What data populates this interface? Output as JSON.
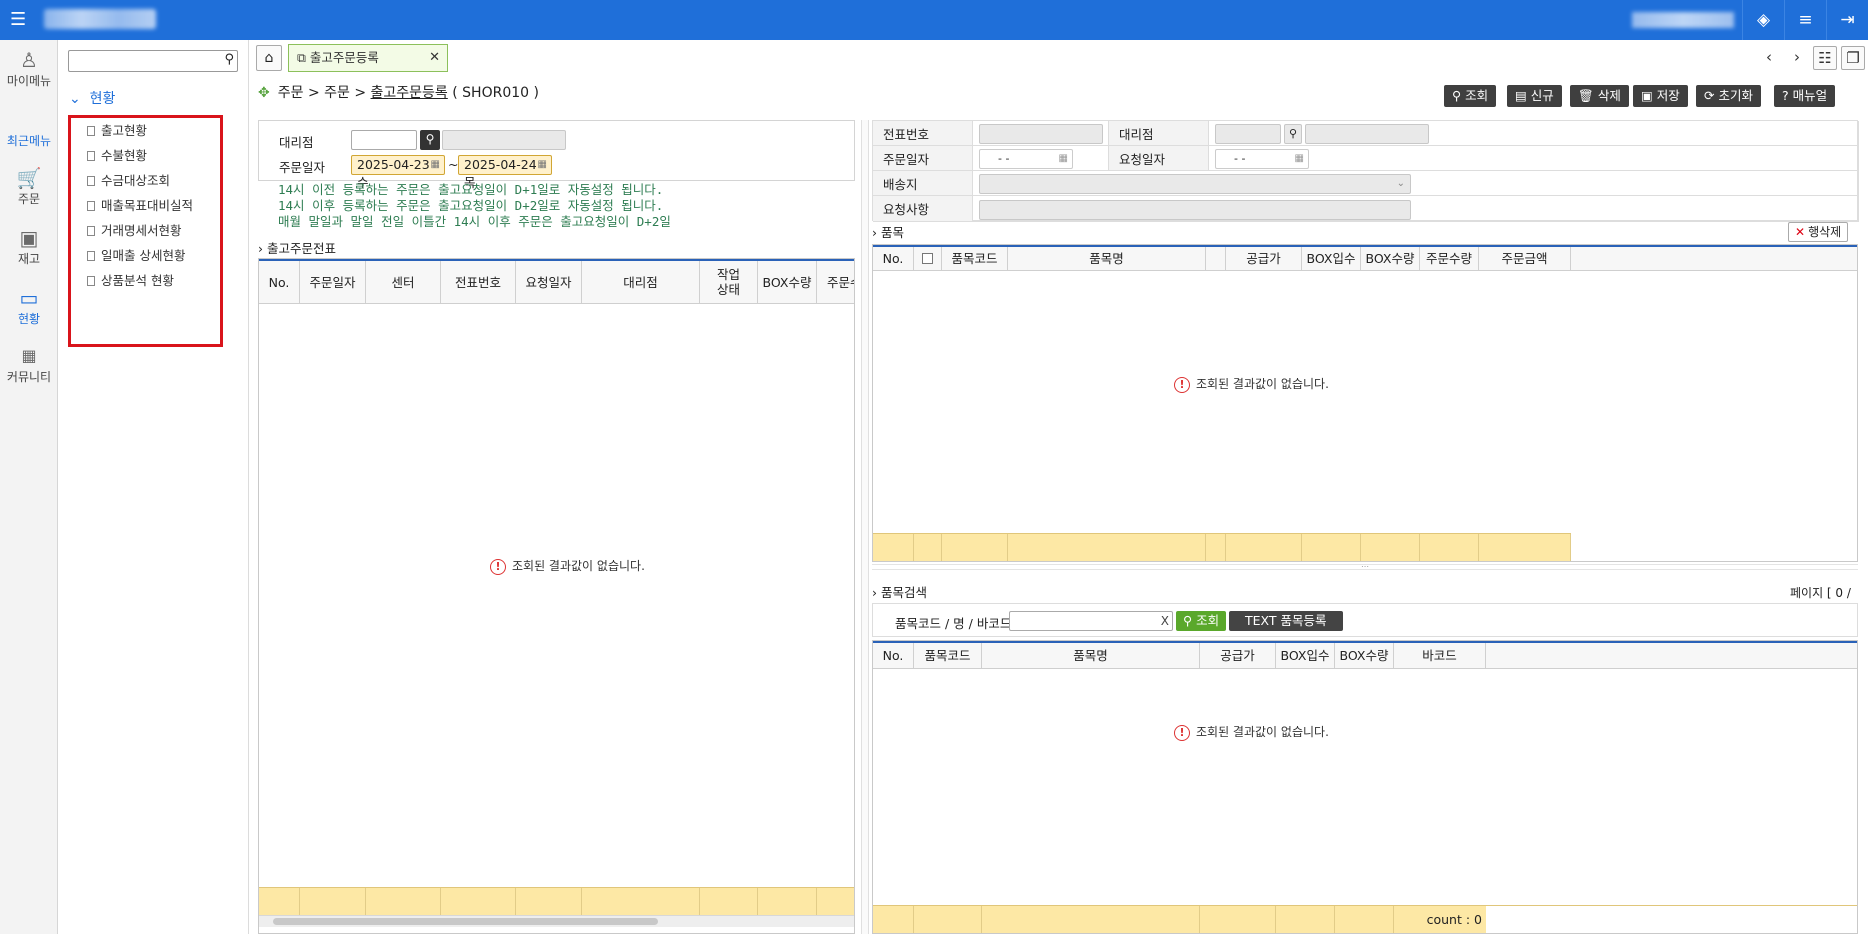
{
  "topbar": {
    "menu_icon": "hamburger-icon",
    "layers_icon": "layers-icon",
    "list_icon": "list-icon",
    "logout_icon": "logout-icon"
  },
  "leftnav": {
    "items": [
      {
        "label": "마이메뉴",
        "icon": "user-icon"
      },
      {
        "label": "최근메뉴",
        "icon": ""
      },
      {
        "label": "주문",
        "icon": "cart-icon"
      },
      {
        "label": "재고",
        "icon": "box-icon"
      },
      {
        "label": "현황",
        "icon": "monitor-icon"
      },
      {
        "label": "커뮤니티",
        "icon": "calendar-icon"
      }
    ]
  },
  "submenu": {
    "search_value": "",
    "group": "현황",
    "items": [
      "출고현황",
      "수불현황",
      "수금대상조회",
      "매출목표대비실적",
      "거래명세서현황",
      "일매출 상세현황",
      "상품분석 현황"
    ]
  },
  "tabs": {
    "active": "출고주문등록"
  },
  "breadcrumb": {
    "path": "주문 > 주문 > ",
    "current": "출고주문등록",
    "code": " ( SHOR010 )"
  },
  "toolbar": {
    "search": "조회",
    "new": "신규",
    "delete": "삭제",
    "save": "저장",
    "reset": "초기화",
    "manual": "매뉴얼"
  },
  "filter": {
    "agency_label": "대리점",
    "agency_code": "",
    "agency_name": "",
    "date_label": "주문일자",
    "date_from": "2025-04-23 수",
    "tilde": "~",
    "date_to": "2025-04-24 목"
  },
  "notices": [
    "14시 이전 등록하는 주문은 출고요청일이 D+1일로 자동설정 됩니다.",
    "14시 이후 등록하는 주문은 출고요청일이 D+2일로 자동설정 됩니다.",
    "매월 말일과 말일 전일 이틀간 14시 이후 주문은 출고요청일이 D+2일"
  ],
  "left_grid": {
    "title": "출고주문전표",
    "columns": [
      "No.",
      "주문일자",
      "센터",
      "전표번호",
      "요청일자",
      "대리점",
      "작업\n상태",
      "BOX수량",
      "주문수"
    ],
    "empty_message": "조회된 결과값이 없습니다."
  },
  "detail_form": {
    "slip_no_label": "전표번호",
    "agency_label": "대리점",
    "order_date_label": "주문일자",
    "order_date_value": "- -",
    "request_date_label": "요청일자",
    "request_date_value": "- -",
    "ship_to_label": "배송지",
    "remarks_label": "요청사항"
  },
  "items_grid": {
    "title": "품목",
    "delete_row_button": "행삭제",
    "columns": [
      "No.",
      "",
      "품목코드",
      "품목명",
      "",
      "공급가",
      "BOX입수",
      "BOX수량",
      "주문수량",
      "주문금액"
    ],
    "empty_message": "조회된 결과값이 없습니다."
  },
  "item_search": {
    "title": "품목검색",
    "page_info": "페이지 [ 0 /",
    "field_label": "품목코드 / 명 / 바코드",
    "field_value": "",
    "clear_label": "X",
    "search_button": "조회",
    "text_register_button": "TEXT 품목등록",
    "columns": [
      "No.",
      "품목코드",
      "품목명",
      "공급가",
      "BOX입수",
      "BOX수량",
      "바코드"
    ],
    "empty_message": "조회된 결과값이 없습니다.",
    "count_label": "count : 0"
  },
  "colors": {
    "brand_blue": "#1f6fd9",
    "highlight_red": "#d9141b",
    "footer_yellow": "#fde8a5",
    "notice_green": "#2e7d52"
  }
}
